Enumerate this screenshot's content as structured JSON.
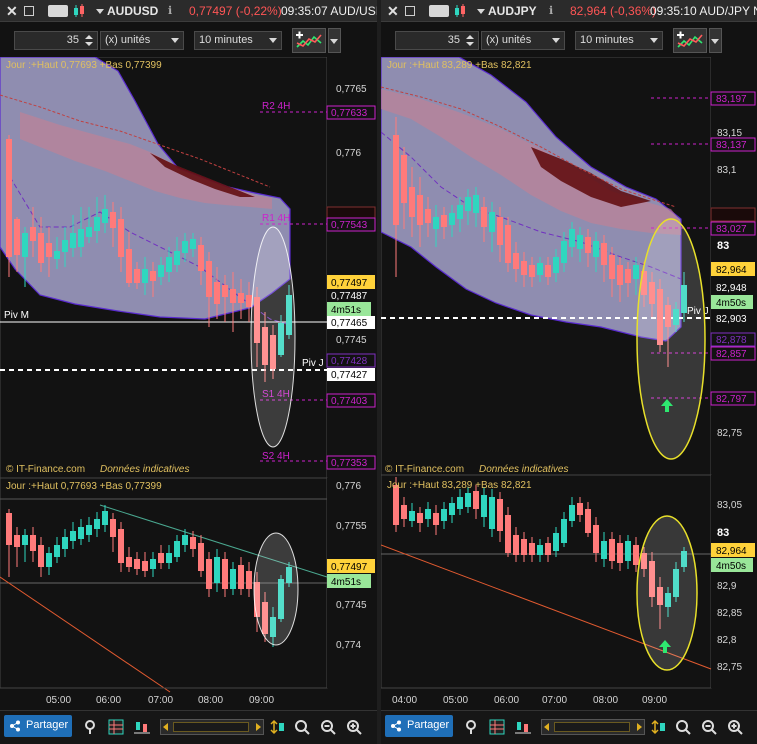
{
  "panels": [
    {
      "title": {
        "symbol": "AUDUSD",
        "price_change": "0,77497 (-0,22%)",
        "time": "09:35:07 AUD/USI"
      },
      "toolbar": {
        "quantity": "35",
        "unit": "(x) unités",
        "interval": "10 minutes"
      },
      "upper_chart": {
        "legend": "Jour :+Haut 0,77693 +Bas 0,77399",
        "watermark_source": "© IT-Finance.com",
        "watermark_note": "Données indicatives",
        "price_ticks": [
          "0,7765",
          "0,776",
          "0,7755",
          "0,775",
          "0,7745"
        ],
        "tags": {
          "last": "0,77497",
          "prev": "0,77487",
          "countdown": "4m51s",
          "pivot_m": "0,77465",
          "pivot_j": "0,77427",
          "overlap": "0,77428"
        },
        "pivots": [
          {
            "label": "R2 4H",
            "value": "0,77633"
          },
          {
            "label": "R1 4H",
            "value": "0,77543"
          },
          {
            "label": "S1 4H",
            "value": "0,77403"
          },
          {
            "label": "S2 4H",
            "value": "0,77353"
          }
        ],
        "piv_left": "Piv M",
        "piv_right": "Piv J"
      },
      "lower_chart": {
        "legend": "Jour :+Haut 0,77693 +Bas 0,77399",
        "price_ticks": [
          "0,776",
          "0,7755",
          "0,775",
          "0,7745",
          "0,774"
        ],
        "tags": {
          "last": "0,77497",
          "countdown": "4m51s"
        },
        "time_ticks": [
          "05:00",
          "06:00",
          "07:00",
          "08:00",
          "09:00"
        ]
      },
      "bottom": {
        "share": "Partager"
      }
    },
    {
      "title": {
        "symbol": "AUDJPY",
        "price_change": "82,964 (-0,36%)",
        "time": "09:35:10 AUD/JPY N"
      },
      "toolbar": {
        "quantity": "35",
        "unit": "(x) unités",
        "interval": "10 minutes"
      },
      "upper_chart": {
        "legend": "Jour :+Haut 83,289 +Bas 82,821",
        "watermark_source": "© IT-Finance.com",
        "watermark_note": "Données indicatives",
        "price_ticks": [
          "83,15",
          "83,1",
          "83",
          "82,75"
        ],
        "tags": {
          "last": "82,964",
          "prev": "82,948",
          "countdown": "4m50s",
          "pivot_m": "82,903",
          "pivot_j": "82,857",
          "overlap": "82,878",
          "big": "83"
        },
        "pivots": [
          {
            "label": "",
            "value": "83,197"
          },
          {
            "label": "",
            "value": "83,137"
          },
          {
            "label": "",
            "value": "83,027"
          },
          {
            "label": "",
            "value": "82,797"
          }
        ],
        "piv_left": "",
        "piv_right": "Piv J"
      },
      "lower_chart": {
        "legend": "Jour :+Haut 83,289 +Bas 82,821",
        "price_ticks": [
          "83,05",
          "83",
          "82,9",
          "82,85",
          "82,8",
          "82,75"
        ],
        "tags": {
          "last": "82,964",
          "countdown": "4m50s"
        },
        "time_ticks": [
          "04:00",
          "05:00",
          "06:00",
          "07:00",
          "08:00",
          "09:00"
        ]
      },
      "bottom": {
        "share": "Partager"
      }
    }
  ],
  "colors": {
    "bull": "#2fd6bf",
    "bear": "#ff7a7a",
    "pivot": "#cc22cc",
    "cloud": "#b9b7e6",
    "price_tag": "#ffd23a",
    "countdown_tag": "#99e699"
  }
}
